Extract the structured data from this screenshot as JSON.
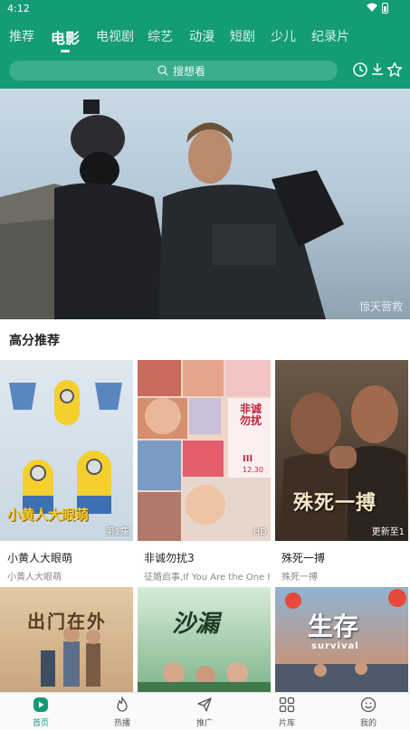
{
  "status_bar": {
    "time": "4:12",
    "icons": [
      "wifi-icon",
      "battery-icon"
    ]
  },
  "tabs": [
    {
      "label": "推荐",
      "active": false
    },
    {
      "label": "电影",
      "active": true
    },
    {
      "label": "电视剧",
      "active": false
    },
    {
      "label": "综艺",
      "active": false
    },
    {
      "label": "动漫",
      "active": false
    },
    {
      "label": "短剧",
      "active": false
    },
    {
      "label": "少儿",
      "active": false
    },
    {
      "label": "纪录片",
      "active": false
    }
  ],
  "search": {
    "placeholder": "搜想看",
    "icon": "search-icon"
  },
  "header_icons": [
    "history-icon",
    "download-icon",
    "star-icon"
  ],
  "banner": {
    "caption": "惊天营救"
  },
  "section": {
    "title": "高分推荐"
  },
  "cards": [
    {
      "title": "小黄人大眼萌",
      "subtitle": "小黄人大眼萌",
      "badge": "第1集",
      "poster_text": "小黄人大眼萌"
    },
    {
      "title": "非诚勿扰3",
      "subtitle": "征婚启事,If You Are the One III",
      "badge": "HD",
      "poster_text": "非诚勿扰",
      "poster_roman": "III",
      "poster_date": "12.30"
    },
    {
      "title": "殊死一搏",
      "subtitle": "殊死一搏",
      "badge": "更新至1",
      "poster_text": "殊死一搏"
    }
  ],
  "row2_posters": [
    {
      "poster_text": "出门在外"
    },
    {
      "poster_text": "沙漏"
    },
    {
      "poster_text": "生存",
      "poster_sub": "survival"
    }
  ],
  "bottom_nav": [
    {
      "label": "首页",
      "icon": "home-play-icon",
      "active": true
    },
    {
      "label": "热播",
      "icon": "flame-icon",
      "active": false
    },
    {
      "label": "推广",
      "icon": "send-icon",
      "active": false
    },
    {
      "label": "片库",
      "icon": "grid-icon",
      "active": false
    },
    {
      "label": "我的",
      "icon": "smile-icon",
      "active": false
    }
  ],
  "colors": {
    "brand": "#149b78",
    "search_bg": "#3bae8f",
    "nav_active": "#149b78"
  }
}
